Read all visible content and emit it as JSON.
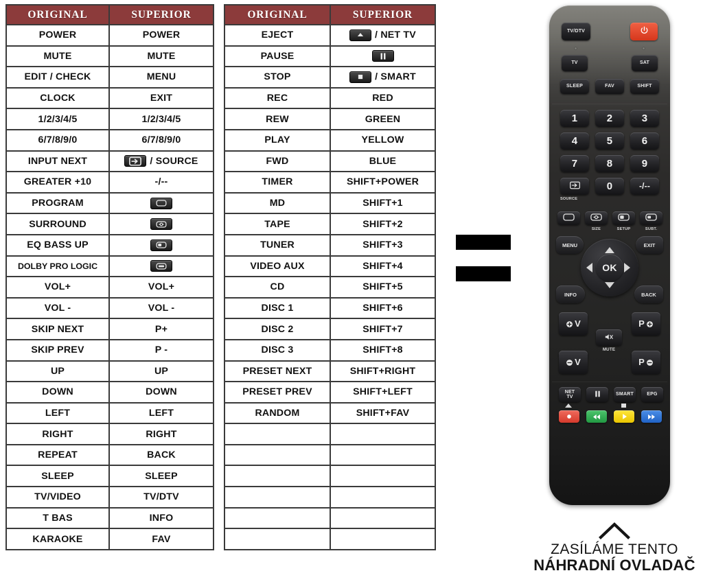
{
  "tables": [
    {
      "id": "table-1",
      "headers": [
        "ORIGINAL",
        "SUPERIOR"
      ],
      "rows": [
        {
          "original": "POWER",
          "superior": "POWER"
        },
        {
          "original": "MUTE",
          "superior": "MUTE"
        },
        {
          "original": "EDIT / CHECK",
          "superior": "MENU"
        },
        {
          "original": "CLOCK",
          "superior": "EXIT"
        },
        {
          "original": "1/2/3/4/5",
          "superior": "1/2/3/4/5"
        },
        {
          "original": "6/7/8/9/0",
          "superior": "6/7/8/9/0"
        },
        {
          "original": "INPUT NEXT",
          "superior": "/ SOURCE",
          "icon": "source-icon"
        },
        {
          "original": "GREATER +10",
          "superior": "-/--"
        },
        {
          "original": "PROGRAM",
          "superior": "",
          "icon": "size-icon"
        },
        {
          "original": "SURROUND",
          "superior": "",
          "icon": "setup-icon"
        },
        {
          "original": "EQ BASS UP",
          "superior": "",
          "icon": "subtitle-icon"
        },
        {
          "original": "DOLBY PRO LOGIC",
          "superior": "",
          "icon": "teletext-icon",
          "small": true
        },
        {
          "original": "VOL+",
          "superior": "VOL+"
        },
        {
          "original": "VOL -",
          "superior": "VOL -"
        },
        {
          "original": "SKIP NEXT",
          "superior": "P+"
        },
        {
          "original": "SKIP PREV",
          "superior": "P -"
        },
        {
          "original": "UP",
          "superior": "UP"
        },
        {
          "original": "DOWN",
          "superior": "DOWN"
        },
        {
          "original": "LEFT",
          "superior": "LEFT"
        },
        {
          "original": "RIGHT",
          "superior": "RIGHT"
        },
        {
          "original": "REPEAT",
          "superior": "BACK"
        },
        {
          "original": "SLEEP",
          "superior": "SLEEP"
        },
        {
          "original": "TV/VIDEO",
          "superior": "TV/DTV"
        },
        {
          "original": "T BAS",
          "superior": "INFO"
        },
        {
          "original": "KARAOKE",
          "superior": "FAV"
        }
      ]
    },
    {
      "id": "table-2",
      "headers": [
        "ORIGINAL",
        "SUPERIOR"
      ],
      "rows": [
        {
          "original": "EJECT",
          "superior": "/ NET TV",
          "icon": "eject-icon"
        },
        {
          "original": "PAUSE",
          "superior": "",
          "icon": "pause-icon"
        },
        {
          "original": "STOP",
          "superior": "/ SMART",
          "icon": "stop-icon"
        },
        {
          "original": "REC",
          "superior": "RED"
        },
        {
          "original": "REW",
          "superior": "GREEN"
        },
        {
          "original": "PLAY",
          "superior": "YELLOW"
        },
        {
          "original": "FWD",
          "superior": "BLUE"
        },
        {
          "original": "TIMER",
          "superior": "SHIFT+POWER"
        },
        {
          "original": "MD",
          "superior": "SHIFT+1"
        },
        {
          "original": "TAPE",
          "superior": "SHIFT+2"
        },
        {
          "original": "TUNER",
          "superior": "SHIFT+3"
        },
        {
          "original": "VIDEO AUX",
          "superior": "SHIFT+4"
        },
        {
          "original": "CD",
          "superior": "SHIFT+5"
        },
        {
          "original": "DISC 1",
          "superior": "SHIFT+6"
        },
        {
          "original": "DISC 2",
          "superior": "SHIFT+7"
        },
        {
          "original": "DISC 3",
          "superior": "SHIFT+8"
        },
        {
          "original": "PRESET NEXT",
          "superior": "SHIFT+RIGHT"
        },
        {
          "original": "PRESET PREV",
          "superior": "SHIFT+LEFT"
        },
        {
          "original": "RANDOM",
          "superior": "SHIFT+FAV"
        },
        {
          "original": "",
          "superior": ""
        },
        {
          "original": "",
          "superior": ""
        },
        {
          "original": "",
          "superior": ""
        },
        {
          "original": "",
          "superior": ""
        },
        {
          "original": "",
          "superior": ""
        },
        {
          "original": "",
          "superior": ""
        }
      ]
    }
  ],
  "remote": {
    "keys": {
      "tv_dtv": "TV/DTV",
      "power": "power-icon",
      "tv": "TV",
      "sat": "SAT",
      "sleep": "SLEEP",
      "fav": "FAV",
      "shift": "SHIFT",
      "n1": "1",
      "n2": "2",
      "n3": "3",
      "n4": "4",
      "n5": "5",
      "n6": "6",
      "n7": "7",
      "n8": "8",
      "n9": "9",
      "source": "SOURCE",
      "n0": "0",
      "dash": "-/--",
      "size": "SIZE",
      "setup": "SETUP",
      "subt": "SUBT.",
      "menu": "MENU",
      "exit": "EXIT",
      "ok": "OK",
      "info": "INFO",
      "back": "BACK",
      "vol_up": "V",
      "vol_down": "V",
      "mute": "MUTE",
      "prog_up": "P",
      "prog_down": "P",
      "net_tv": "NET\nTV",
      "net_tv_line1": "NET",
      "net_tv_line2": "TV",
      "pause": "pause-icon",
      "smart": "SMART",
      "epg": "EPG",
      "record": "record-icon",
      "rewind": "rewind-icon",
      "play": "play-icon",
      "forward": "forward-icon"
    },
    "colors": {
      "power": "#d6371c",
      "red": "#e0453a",
      "green": "#2eab4f",
      "yellow": "#f2d00a",
      "blue": "#2b72d6",
      "body": "#2c2b2a"
    }
  },
  "footer": {
    "chevron": "chevron-up-icon",
    "line1": "ZASÍLÁME TENTO",
    "line2": "NÁHRADNÍ OVLADAČ"
  },
  "redactions": {
    "count": 2,
    "color": "#000000"
  }
}
